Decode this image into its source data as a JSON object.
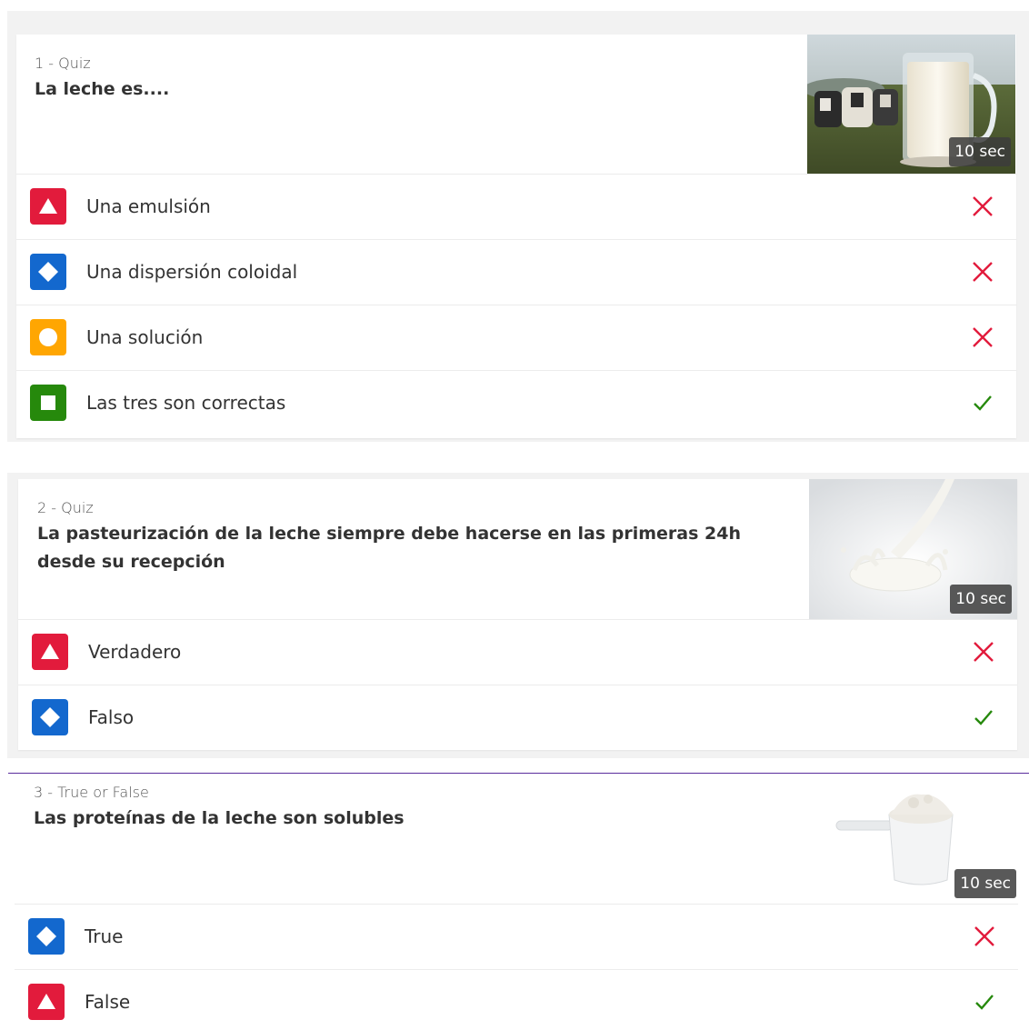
{
  "colors": {
    "red": "#e21b3c",
    "blue": "#1368ce",
    "yellow": "#ffa602",
    "green": "#26890c",
    "wrong": "#e21b3c",
    "correct": "#26890c"
  },
  "questions": [
    {
      "meta": "1 - Quiz",
      "title": "La leche es....",
      "time": "10 sec",
      "image": "glass-of-milk-with-cows",
      "answers": [
        {
          "shape": "triangle-icon",
          "color": "red",
          "text": "Una emulsión",
          "result": "wrong"
        },
        {
          "shape": "diamond-icon",
          "color": "blue",
          "text": "Una dispersión coloidal",
          "result": "wrong"
        },
        {
          "shape": "circle-icon",
          "color": "yellow",
          "text": "Una solución",
          "result": "wrong"
        },
        {
          "shape": "square-icon",
          "color": "green",
          "text": "Las tres son correctas",
          "result": "correct"
        }
      ]
    },
    {
      "meta": "2 - Quiz",
      "title": "La pasteurización de la leche siempre debe hacerse en las primeras 24h desde su recepción",
      "time": "10 sec",
      "image": "milk-splash",
      "answers": [
        {
          "shape": "triangle-icon",
          "color": "red",
          "text": "Verdadero",
          "result": "wrong"
        },
        {
          "shape": "diamond-icon",
          "color": "blue",
          "text": "Falso",
          "result": "correct"
        }
      ]
    },
    {
      "meta": "3 - True or False",
      "title": "Las proteínas de la leche son solubles",
      "time": "10 sec",
      "image": "protein-powder-scoop",
      "answers": [
        {
          "shape": "diamond-icon",
          "color": "blue",
          "text": "True",
          "result": "wrong"
        },
        {
          "shape": "triangle-icon",
          "color": "red",
          "text": "False",
          "result": "correct"
        }
      ]
    }
  ]
}
